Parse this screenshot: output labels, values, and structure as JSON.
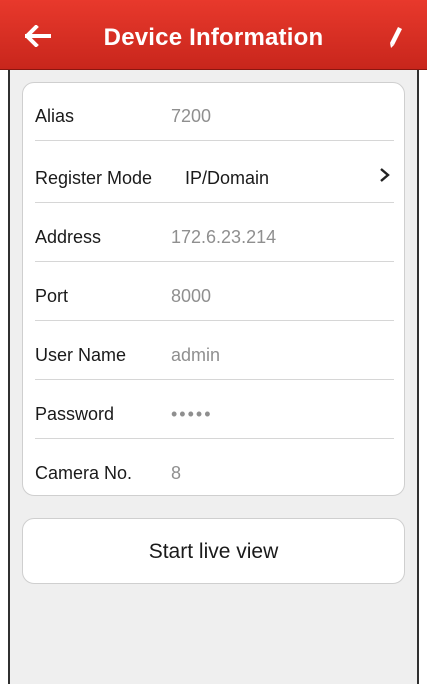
{
  "header": {
    "title": "Device Information",
    "back_icon": "arrow-left-icon",
    "edit_icon": "pencil-icon",
    "bg_color": "#d62f23"
  },
  "device": {
    "rows": [
      {
        "label": "Alias",
        "value": "7200"
      },
      {
        "label": "Register Mode",
        "value": "IP/Domain"
      },
      {
        "label": "Address",
        "value": "172.6.23.214"
      },
      {
        "label": "Port",
        "value": "8000"
      },
      {
        "label": "User Name",
        "value": "admin"
      },
      {
        "label": "Password",
        "value": "•••••"
      },
      {
        "label": "Camera No.",
        "value": "8"
      }
    ],
    "register_mode_icon": "chevron-right-icon"
  },
  "actions": {
    "start_live_view_label": "Start live view"
  }
}
